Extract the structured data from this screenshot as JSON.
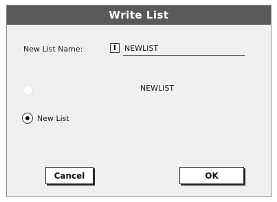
{
  "dialog": {
    "title": "Write List",
    "name_label": "New List Name:",
    "name_value": "NEWLIST",
    "cursor_glyph": "I",
    "options": [
      {
        "label": "",
        "target_name": "NEWLIST",
        "selected": false,
        "enabled": false
      },
      {
        "label": "New List",
        "selected": true,
        "enabled": true
      }
    ],
    "buttons": {
      "cancel": "Cancel",
      "ok": "OK"
    }
  }
}
